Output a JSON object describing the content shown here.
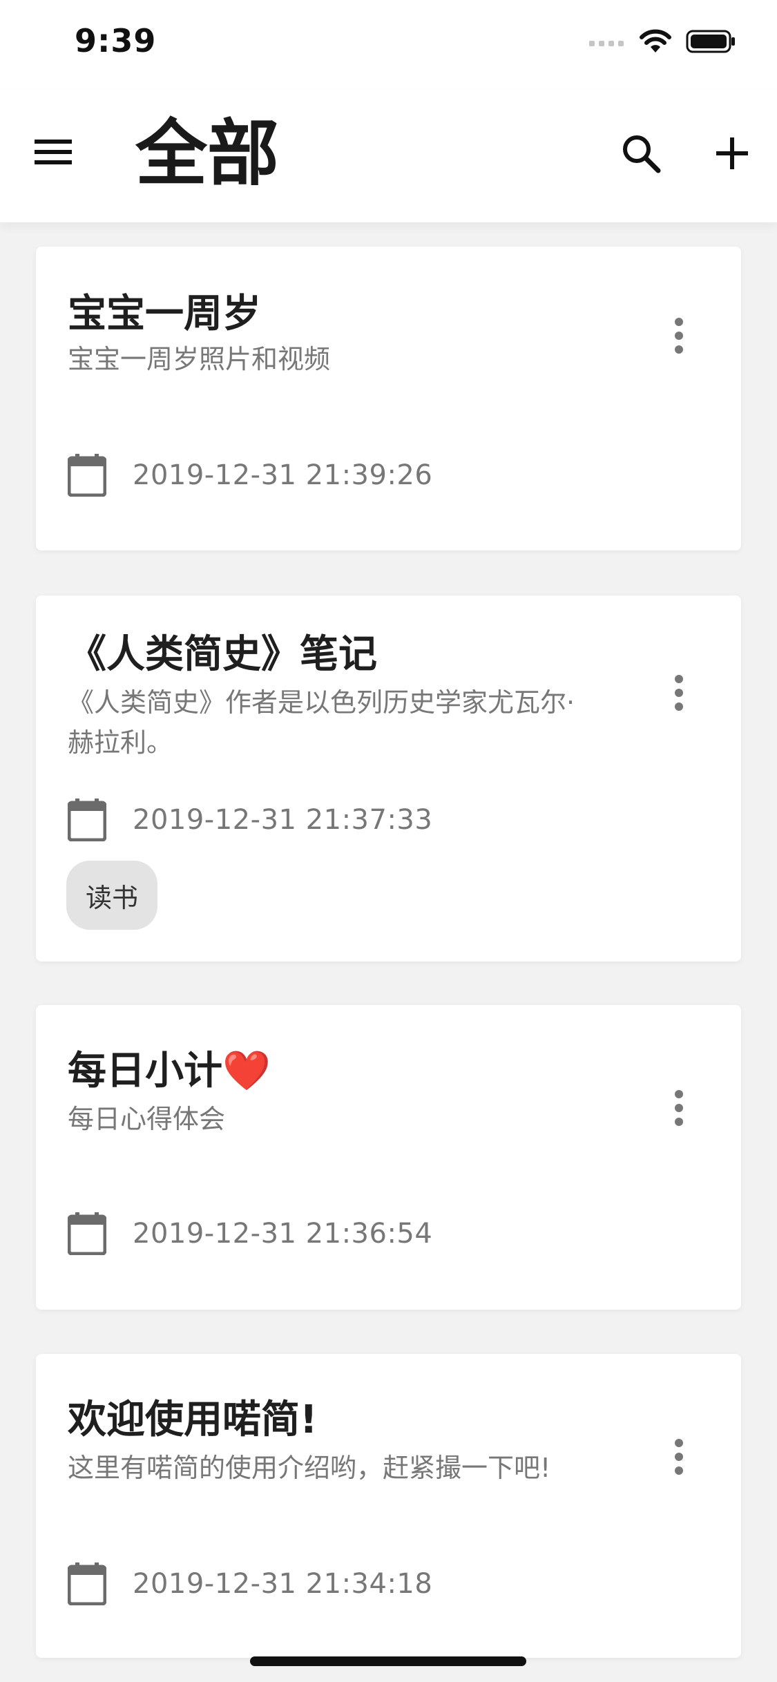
{
  "status_bar": {
    "time": "9:39"
  },
  "header": {
    "title": "全部",
    "menu_icon": "menu-icon",
    "search_icon": "search-icon",
    "add_icon": "plus-icon"
  },
  "cards": [
    {
      "title": "宝宝一周岁",
      "description": "宝宝一周岁照片和视频",
      "date": "2019-12-31 21:39:26",
      "tag": ""
    },
    {
      "title": "《人类简史》笔记",
      "description": "《人类简史》作者是以色列历史学家尤瓦尔·赫拉利。",
      "date": "2019-12-31 21:37:33",
      "tag": "读书"
    },
    {
      "title": "每日小计❤️",
      "description": "每日心得体会",
      "date": "2019-12-31 21:36:54",
      "tag": ""
    },
    {
      "title": "欢迎使用喏简!",
      "description": "这里有喏简的使用介绍哟，赶紧撮一下吧!",
      "date": "2019-12-31 21:34:18",
      "tag": ""
    }
  ],
  "colors": {
    "background": "#f2f2f2",
    "card": "#ffffff",
    "title": "#1f1f1f",
    "secondary_text": "#777777",
    "tag_bg": "#e3e3e3"
  }
}
